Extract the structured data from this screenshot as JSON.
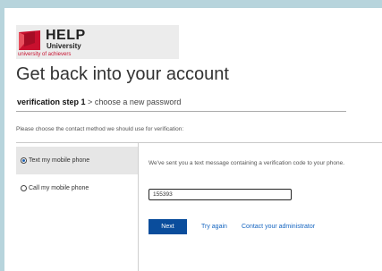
{
  "logo": {
    "name": "HELP",
    "subname": "University",
    "tagline": "university of achievers"
  },
  "page": {
    "title": "Get back into your account",
    "step_current": "verification step 1",
    "step_separator": ">",
    "step_next": "choose a new password",
    "instructions": "Please choose the contact method we should use for verification:"
  },
  "options": [
    {
      "label": "Text my mobile phone",
      "selected": true
    },
    {
      "label": "Call my mobile phone",
      "selected": false
    }
  ],
  "verification": {
    "message": "We've sent you a text message containing a verification code to your phone.",
    "code_value": "155393"
  },
  "actions": {
    "next_label": "Next",
    "try_again_label": "Try again",
    "contact_admin_label": "Contact your administrator"
  },
  "colors": {
    "background": "#b7d4dc",
    "primary_button": "#0a4d9c",
    "link": "#1565c0",
    "brand_red": "#c8102e"
  }
}
